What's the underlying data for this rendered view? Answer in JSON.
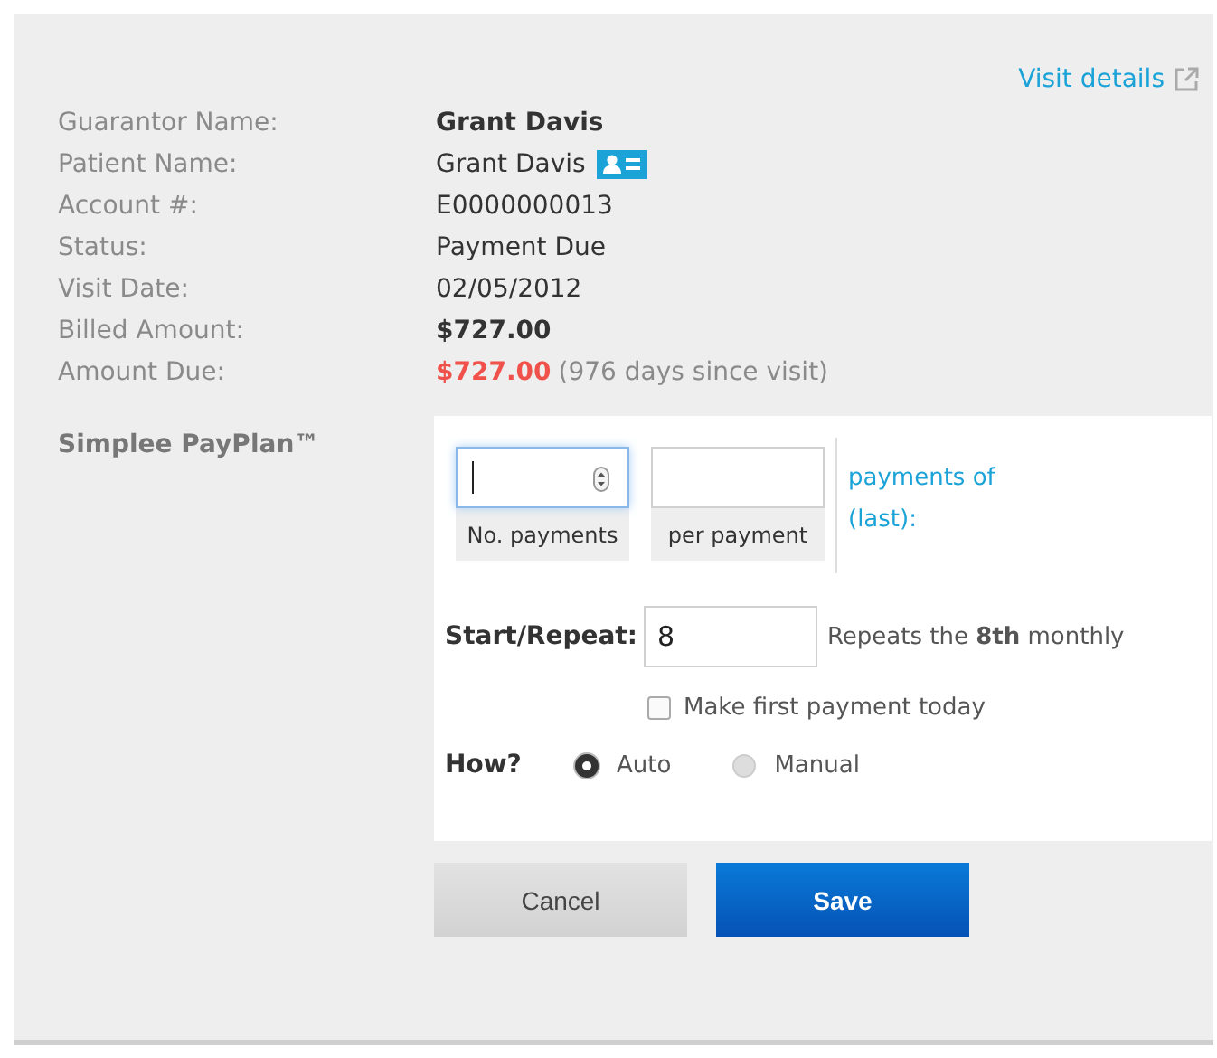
{
  "visit_link": "Visit details",
  "fields": [
    {
      "label": "Guarantor Name:",
      "value": "Grant Davis",
      "kind": "bold"
    },
    {
      "label": "Patient Name:",
      "value": "Grant Davis",
      "kind": "card"
    },
    {
      "label": "Account #:",
      "value": "E0000000013",
      "kind": "plain"
    },
    {
      "label": "Status:",
      "value": "Payment Due",
      "kind": "plain"
    },
    {
      "label": "Visit Date:",
      "value": "02/05/2012",
      "kind": "plain"
    },
    {
      "label": "Billed Amount:",
      "value": "$727.00",
      "kind": "bold"
    },
    {
      "label": "Amount Due:",
      "value": "$727.00",
      "note": "(976 days since visit)",
      "kind": "due"
    }
  ],
  "payplan": {
    "title": "Simplee PayPlan™",
    "no_payments": {
      "label": "No. payments",
      "focused": true
    },
    "per_payment": {
      "label": "per payment"
    },
    "payments_text": "payments of (last):",
    "start_label": "Start/Repeat:",
    "start_value": "8",
    "repeat_text": "Repeats the **8th** monthly",
    "first_today": {
      "label": "Make first payment today",
      "checked": false
    },
    "how_label": "How?",
    "methods": [
      {
        "label": "Auto",
        "selected": true,
        "disabled": false
      },
      {
        "label": "Manual",
        "selected": false,
        "disabled": true
      }
    ]
  },
  "buttons": [
    {
      "label": "Cancel",
      "kind": "secondary"
    },
    {
      "label": "Save",
      "kind": "primary"
    }
  ]
}
